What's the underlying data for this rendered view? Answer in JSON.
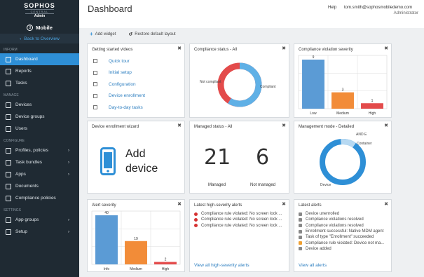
{
  "brand": {
    "name": "SOPHOS",
    "sub": "CENTRAL",
    "role": "Admin"
  },
  "product": {
    "label": "Mobile",
    "icon": "mobile-icon"
  },
  "back": "Back to Overview",
  "nav": [
    {
      "section": "INFORM"
    },
    {
      "label": "Dashboard",
      "icon": "dashboard-icon",
      "active": true
    },
    {
      "label": "Reports",
      "icon": "reports-icon"
    },
    {
      "label": "Tasks",
      "icon": "tasks-icon"
    },
    {
      "section": "MANAGE"
    },
    {
      "label": "Devices",
      "icon": "devices-icon"
    },
    {
      "label": "Device groups",
      "icon": "device-groups-icon"
    },
    {
      "label": "Users",
      "icon": "users-icon"
    },
    {
      "section": "CONFIGURE"
    },
    {
      "label": "Profiles, policies",
      "icon": "profiles-icon",
      "chev": true
    },
    {
      "label": "Task bundles",
      "icon": "task-bundles-icon",
      "chev": true
    },
    {
      "label": "Apps",
      "icon": "apps-icon",
      "chev": true
    },
    {
      "label": "Documents",
      "icon": "documents-icon"
    },
    {
      "label": "Compliance policies",
      "icon": "compliance-icon"
    },
    {
      "section": "SETTINGS"
    },
    {
      "label": "App groups",
      "icon": "app-groups-icon",
      "chev": true
    },
    {
      "label": "Setup",
      "icon": "setup-icon",
      "chev": true
    }
  ],
  "header": {
    "title": "Dashboard",
    "help": "Help",
    "user": "tom.smith@sophosmobiledemo.com",
    "role": "Administrator"
  },
  "toolbar": {
    "add": "Add widget",
    "restore": "Restore default layout"
  },
  "widgets": {
    "videos": {
      "title": "Getting started videos",
      "items": [
        "Quick tour",
        "Initial setup",
        "Configuration",
        "Device enrollment",
        "Day-to-day tasks"
      ]
    },
    "compliance": {
      "title": "Compliance status - All",
      "left": "Not compliant",
      "right": "Compliant"
    },
    "violation": {
      "title": "Compliance violation severity"
    },
    "enroll": {
      "title": "Device enrollment wizard",
      "line1": "Add",
      "line2": "device"
    },
    "managed": {
      "title": "Managed status - All",
      "a": "21",
      "b": "6",
      "la": "Managed",
      "lb": "Not managed"
    },
    "mode": {
      "title": "Management mode - Detailed",
      "top": "AND E",
      "right": "Container",
      "left": "Device"
    },
    "severity": {
      "title": "Alert severity"
    },
    "high": {
      "title": "Latest high-severity alerts",
      "items": [
        "Compliance rule violated: No screen lock ...",
        "Compliance rule violated: No screen lock ...",
        "Compliance rule violated: No screen lock ..."
      ],
      "link": "View all high-severity alerts"
    },
    "latest": {
      "title": "Latest alerts",
      "items": [
        "Device unenrolled",
        "Compliance violations resolved",
        "Compliance violations resolved",
        "Enrollment successful: Native MDM agent",
        "Task of type \"Enrollment\" succeeded",
        "Compliance rule violated: Device not ma...",
        "Device added"
      ],
      "link": "View all alerts"
    }
  },
  "chart_data": [
    {
      "type": "bar",
      "title": "Compliance violation severity",
      "categories": [
        "Low",
        "Medium",
        "High"
      ],
      "values": [
        9,
        3,
        1
      ],
      "colors": [
        "#5b9bd5",
        "#f28c38",
        "#e34b4b"
      ]
    },
    {
      "type": "bar",
      "title": "Alert severity",
      "categories": [
        "Info",
        "Medium",
        "High"
      ],
      "values": [
        40,
        19,
        2
      ],
      "colors": [
        "#5b9bd5",
        "#f28c38",
        "#e34b4b"
      ]
    }
  ]
}
